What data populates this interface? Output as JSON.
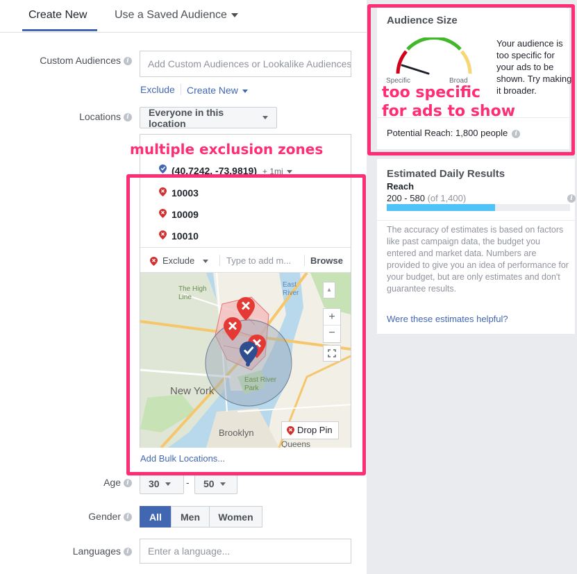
{
  "tabs": {
    "create_new": "Create New",
    "saved_audience": "Use a Saved Audience"
  },
  "custom_audiences": {
    "label": "Custom Audiences",
    "placeholder": "Add Custom Audiences or Lookalike Audiences",
    "exclude": "Exclude",
    "create_new": "Create New"
  },
  "locations": {
    "label": "Locations",
    "dropdown": "Everyone in this location",
    "included": {
      "label": "(40.7242, -73.9819)",
      "radius": "+ 1mi"
    },
    "excluded": [
      "10003",
      "10009",
      "10010"
    ],
    "mode": "Exclude",
    "search_placeholder": "Type to add m...",
    "browse": "Browse",
    "bulk": "Add Bulk Locations...",
    "map": {
      "labels": [
        "The High Line",
        "East River",
        "New York",
        "East River Park",
        "Brooklyn",
        "Queens"
      ],
      "drop_pin": "Drop Pin",
      "zoom_in": "+",
      "zoom_out": "−"
    }
  },
  "age": {
    "label": "Age",
    "min": "30",
    "max": "50",
    "dash": "-"
  },
  "gender": {
    "label": "Gender",
    "options": [
      "All",
      "Men",
      "Women"
    ],
    "selected": "All"
  },
  "languages": {
    "label": "Languages",
    "placeholder": "Enter a language..."
  },
  "audience_size": {
    "title": "Audience Size",
    "gauge_left": "Specific",
    "gauge_right": "Broad",
    "message": "Your audience is too specific for your ads to be shown. Try making it broader.",
    "potential_reach": "Potential Reach: 1,800 people"
  },
  "daily_results": {
    "title": "Estimated Daily Results",
    "reach_label": "Reach",
    "reach_range": "200 - 580",
    "reach_of": "(of 1,400)",
    "reach_fraction": 0.59,
    "disclaimer": "The accuracy of estimates is based on factors like past campaign data, the budget you entered and market data. Numbers are provided to give you an idea of performance for your budget, but are only estimates and don't guarantee results.",
    "helpful_link": "Were these estimates helpful?"
  },
  "annotations": {
    "exclusion": "multiple exclusion zones",
    "specific_line1": "too specific",
    "specific_line2": "for ads to show"
  },
  "colors": {
    "brand": "#4267b2",
    "highlight": "#ff2e74",
    "exclude_pin": "#d32f2f",
    "reach_bar": "#4fc3f7"
  }
}
